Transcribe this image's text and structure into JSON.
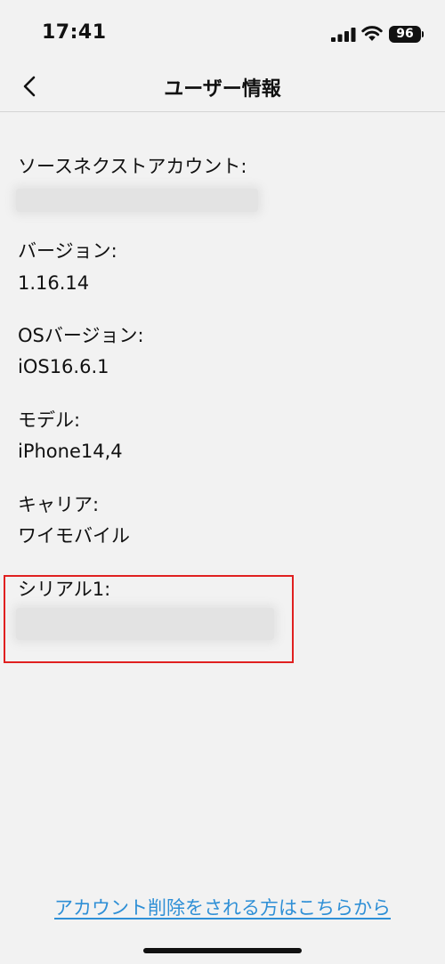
{
  "status_bar": {
    "time": "17:41",
    "battery": "96",
    "icons": [
      "signal-icon",
      "wifi-icon",
      "battery-icon"
    ]
  },
  "nav": {
    "title": "ユーザー情報",
    "back_icon": "chevron-left-icon"
  },
  "info": {
    "account_label": "ソースネクストアカウント:",
    "version_label": "バージョン:",
    "version_value": "1.16.14",
    "os_label": "OSバージョン:",
    "os_value": "iOS16.6.1",
    "model_label": "モデル:",
    "model_value": "iPhone14,4",
    "carrier_label": "キャリア:",
    "carrier_value": "ワイモバイル",
    "serial_label": "シリアル1:"
  },
  "footer": {
    "delete_link": "アカウント削除をされる方はこちらから"
  },
  "colors": {
    "background": "#f2f2f2",
    "link": "#2e8fd6",
    "highlight": "#e02020"
  }
}
